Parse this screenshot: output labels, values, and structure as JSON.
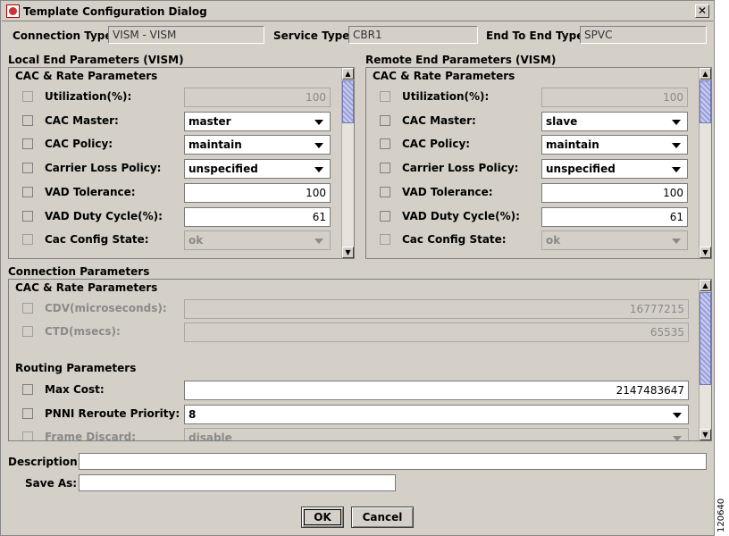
{
  "window": {
    "title": "Template Configuration Dialog",
    "close_glyph": "✕"
  },
  "header": {
    "connection_type_label": "Connection Type:",
    "connection_type_value": "VISM - VISM",
    "service_type_label": "Service Type:",
    "service_type_value": "CBR1",
    "end_to_end_type_label": "End To End Type:",
    "end_to_end_type_value": "SPVC"
  },
  "local": {
    "title": "Local End Parameters (VISM)",
    "section": "CAC & Rate Parameters",
    "rows": [
      {
        "label": "Utilization(%):",
        "kind": "input",
        "value": "100",
        "disabled": true
      },
      {
        "label": "CAC Master:",
        "kind": "combo",
        "value": "master",
        "disabled": false
      },
      {
        "label": "CAC Policy:",
        "kind": "combo",
        "value": "maintain",
        "disabled": false
      },
      {
        "label": "Carrier Loss Policy:",
        "kind": "combo",
        "value": "unspecified",
        "disabled": false
      },
      {
        "label": "VAD Tolerance:",
        "kind": "input",
        "value": "100",
        "disabled": false
      },
      {
        "label": "VAD Duty Cycle(%):",
        "kind": "input",
        "value": "61",
        "disabled": false
      },
      {
        "label": "Cac Config State:",
        "kind": "combo",
        "value": "ok",
        "disabled": true
      }
    ]
  },
  "remote": {
    "title": "Remote End Parameters (VISM)",
    "section": "CAC & Rate Parameters",
    "rows": [
      {
        "label": "Utilization(%):",
        "kind": "input",
        "value": "100",
        "disabled": true
      },
      {
        "label": "CAC Master:",
        "kind": "combo",
        "value": "slave",
        "disabled": false
      },
      {
        "label": "CAC Policy:",
        "kind": "combo",
        "value": "maintain",
        "disabled": false
      },
      {
        "label": "Carrier Loss Policy:",
        "kind": "combo",
        "value": "unspecified",
        "disabled": false
      },
      {
        "label": "VAD Tolerance:",
        "kind": "input",
        "value": "100",
        "disabled": false
      },
      {
        "label": "VAD Duty Cycle(%):",
        "kind": "input",
        "value": "61",
        "disabled": false
      },
      {
        "label": "Cac Config State:",
        "kind": "combo",
        "value": "ok",
        "disabled": true
      }
    ]
  },
  "connection": {
    "title": "Connection Parameters",
    "cac_section": "CAC & Rate Parameters",
    "cac_rows": [
      {
        "label": "CDV(microseconds):",
        "kind": "input",
        "value": "16777215",
        "disabled": true
      },
      {
        "label": "CTD(msecs):",
        "kind": "input",
        "value": "65535",
        "disabled": true
      }
    ],
    "routing_section": "Routing Parameters",
    "routing_rows": [
      {
        "label": "Max Cost:",
        "kind": "input",
        "value": "2147483647",
        "disabled": false
      },
      {
        "label": "PNNI Reroute Priority:",
        "kind": "combo",
        "value": "8",
        "disabled": false
      },
      {
        "label": "Frame Discard:",
        "kind": "combo",
        "value": "disable",
        "disabled": true
      }
    ]
  },
  "footer": {
    "description_label": "Description:",
    "description_value": "",
    "save_as_label": "Save As:",
    "save_as_value": "",
    "ok_label": "OK",
    "cancel_label": "Cancel"
  },
  "figure_code": "120640"
}
